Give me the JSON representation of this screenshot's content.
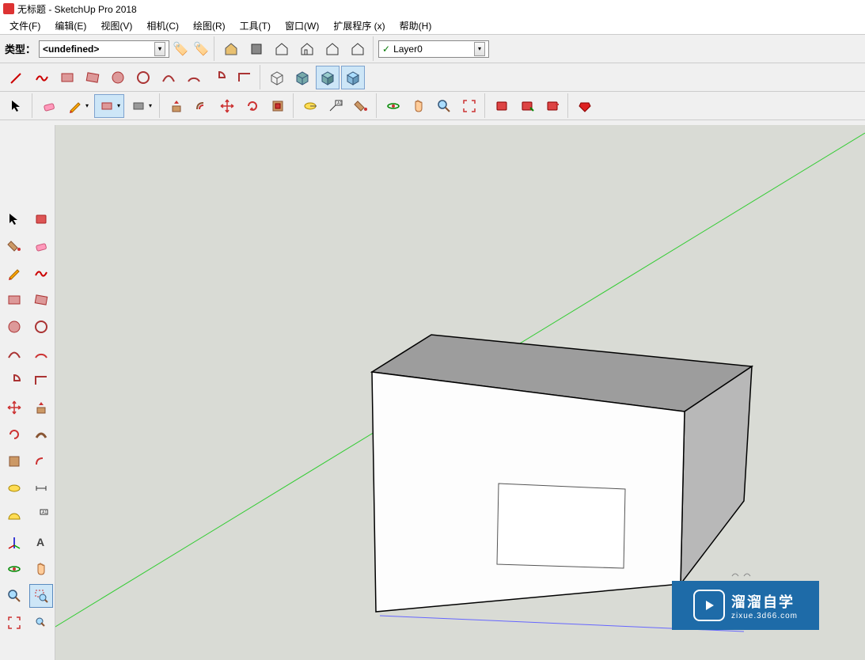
{
  "window": {
    "title": "无标题 - SketchUp Pro 2018"
  },
  "menubar": [
    "文件(F)",
    "编辑(E)",
    "视图(V)",
    "相机(C)",
    "绘图(R)",
    "工具(T)",
    "窗口(W)",
    "扩展程序 (x)",
    "帮助(H)"
  ],
  "type_panel": {
    "label": "类型：",
    "value": "<undefined>"
  },
  "layer_panel": {
    "value": "Layer0"
  },
  "icons": {
    "house": "⌂",
    "cube": "▢",
    "tag": "🏷",
    "arrow_down": "▾",
    "select": "↖",
    "eraser": "◧",
    "pencil": "✎",
    "freehand": "〰",
    "rect": "▭",
    "rot_rect": "◫",
    "circle": "◯",
    "polygon": "⬡",
    "arc1": "◝",
    "arc2": "◞",
    "pie": "◔",
    "curve": "∿",
    "iso": "◈",
    "box_x": "◪",
    "box_front": "◩",
    "box_back": "◨",
    "pushpull": "⇕",
    "move": "✥",
    "rotate": "⟳",
    "scale": "▣",
    "offset": "⊙",
    "tape": "📏",
    "dim": "A¹",
    "paint": "🪣",
    "orbit": "🔄",
    "pan": "✋",
    "zoom": "🔍",
    "zoom_ext": "⤢",
    "book1": "📕",
    "book2": "📗",
    "book3": "📘",
    "ruby": "💎",
    "protractor": "◴",
    "axes": "✛",
    "walk": "🚶"
  },
  "watermark": {
    "name": "溜溜自学",
    "url": "zixue.3d66.com"
  }
}
